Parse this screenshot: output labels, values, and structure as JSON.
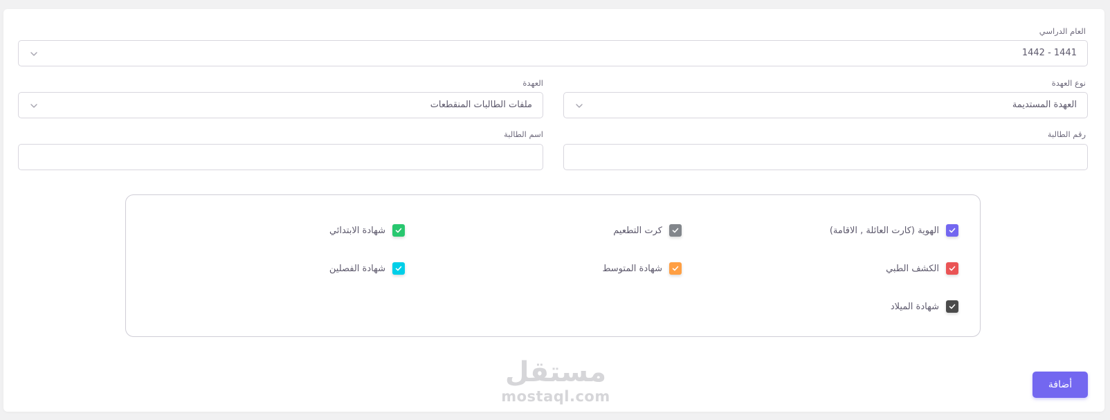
{
  "form": {
    "academic_year": {
      "label": "العام الدراسي",
      "value": "1441 - 1442"
    },
    "custody_type": {
      "label": "نوع العهدة",
      "value": "العهدة المستديمة"
    },
    "custody": {
      "label": "العهدة",
      "value": "ملفات الطالبات المنقطعات"
    },
    "student_number": {
      "label": "رقم الطالبة",
      "value": ""
    },
    "student_name": {
      "label": "اسم الطالبة",
      "value": ""
    }
  },
  "documents": [
    {
      "label": "الهوية (كارت العائلة , الاقامة)",
      "checked": true,
      "color": "#7367f0"
    },
    {
      "label": "كرت التطعيم",
      "checked": true,
      "color": "#82868b"
    },
    {
      "label": "شهادة الابتدائي",
      "checked": true,
      "color": "#28c76f"
    },
    {
      "label": "الكشف الطبي",
      "checked": true,
      "color": "#ea5455"
    },
    {
      "label": "شهادة المتوسط",
      "checked": true,
      "color": "#ff9f43"
    },
    {
      "label": "شهادة الفصلين",
      "checked": true,
      "color": "#00cfe8"
    },
    {
      "label": "شهادة الميلاد",
      "checked": true,
      "color": "#4b4b4b"
    }
  ],
  "actions": {
    "add_label": "أضافة"
  },
  "watermark": {
    "arabic": "مستقل",
    "latin": "mostaql.com"
  },
  "colors": {
    "primary": "#7367f0",
    "border": "#d8d6de",
    "text": "#5d596c"
  },
  "icons": {
    "select": "chevron-down-icon",
    "checkbox": "check-icon"
  }
}
